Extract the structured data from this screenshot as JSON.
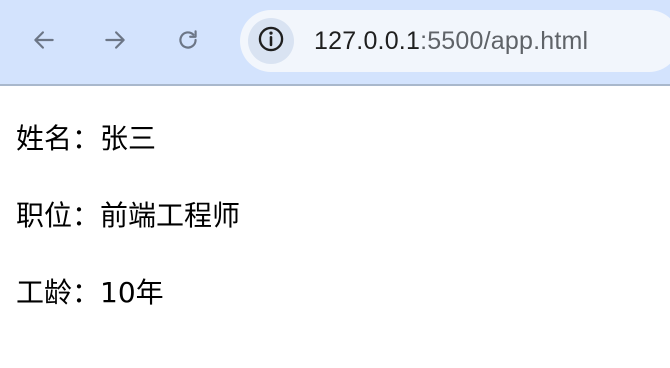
{
  "browser": {
    "url_host": "127.0.0.1",
    "url_rest": ":5500/app.html",
    "icons": {
      "back": "arrow-left-icon",
      "forward": "arrow-right-icon",
      "reload": "reload-icon",
      "site_info": "info-circle-icon"
    },
    "colors": {
      "toolbar_bg": "#d3e3fd",
      "address_bg": "#f2f6fc",
      "icon_color": "#6c7686"
    }
  },
  "page": {
    "name_line": "姓名：张三",
    "title_line": "职位：前端工程师",
    "years_line": "工龄：10年"
  }
}
